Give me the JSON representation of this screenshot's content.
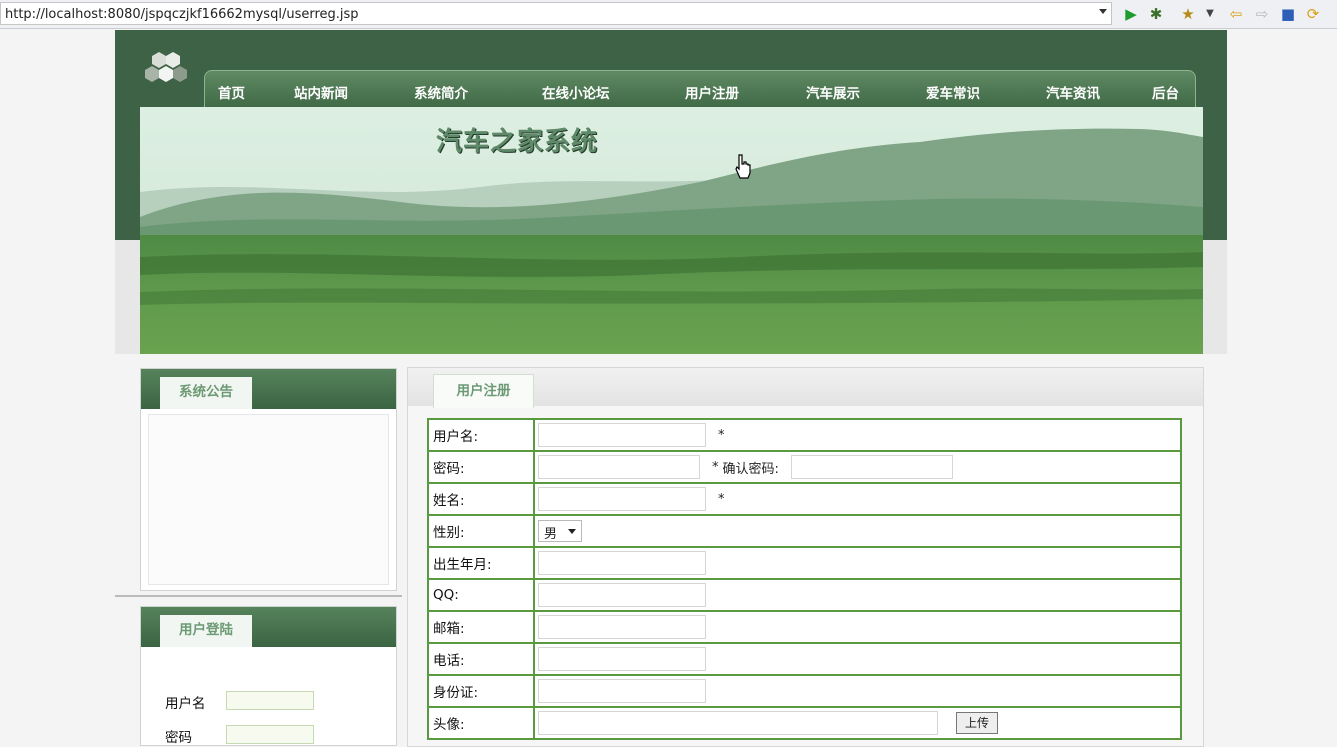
{
  "browser": {
    "url": "http://localhost:8080/jspqczjkf16662mysql/userreg.jsp",
    "toolbar_icons": [
      "run-icon",
      "debug-icon",
      "extension-icon",
      "back-icon",
      "forward-icon",
      "stop-icon",
      "refresh-icon"
    ]
  },
  "header": {
    "title": "汽车之家系统",
    "nav": [
      "首页",
      "站内新闻",
      "系统简介",
      "在线小论坛",
      "用户注册",
      "汽车展示",
      "爱车常识",
      "汽车资讯",
      "后台"
    ]
  },
  "sidebar": {
    "notice_title": "系统公告",
    "login_title": "用户登陆",
    "username_label": "用户名",
    "password_label": "密码"
  },
  "main": {
    "tab_label": "用户注册",
    "form": {
      "username_label": "用户名:",
      "password_label": "密码:",
      "confirm_label": "确认密码:",
      "name_label": "姓名:",
      "gender_label": "性别:",
      "gender_value": "男",
      "birth_label": "出生年月:",
      "qq_label": "QQ:",
      "email_label": "邮箱:",
      "phone_label": "电话:",
      "idcard_label": "身份证:",
      "avatar_label": "头像:",
      "upload_label": "上传",
      "required_mark": "*"
    }
  },
  "colors": {
    "header_green": "#3d6245",
    "border_green": "#5a9a3e",
    "tab_text": "#6c9a74"
  }
}
